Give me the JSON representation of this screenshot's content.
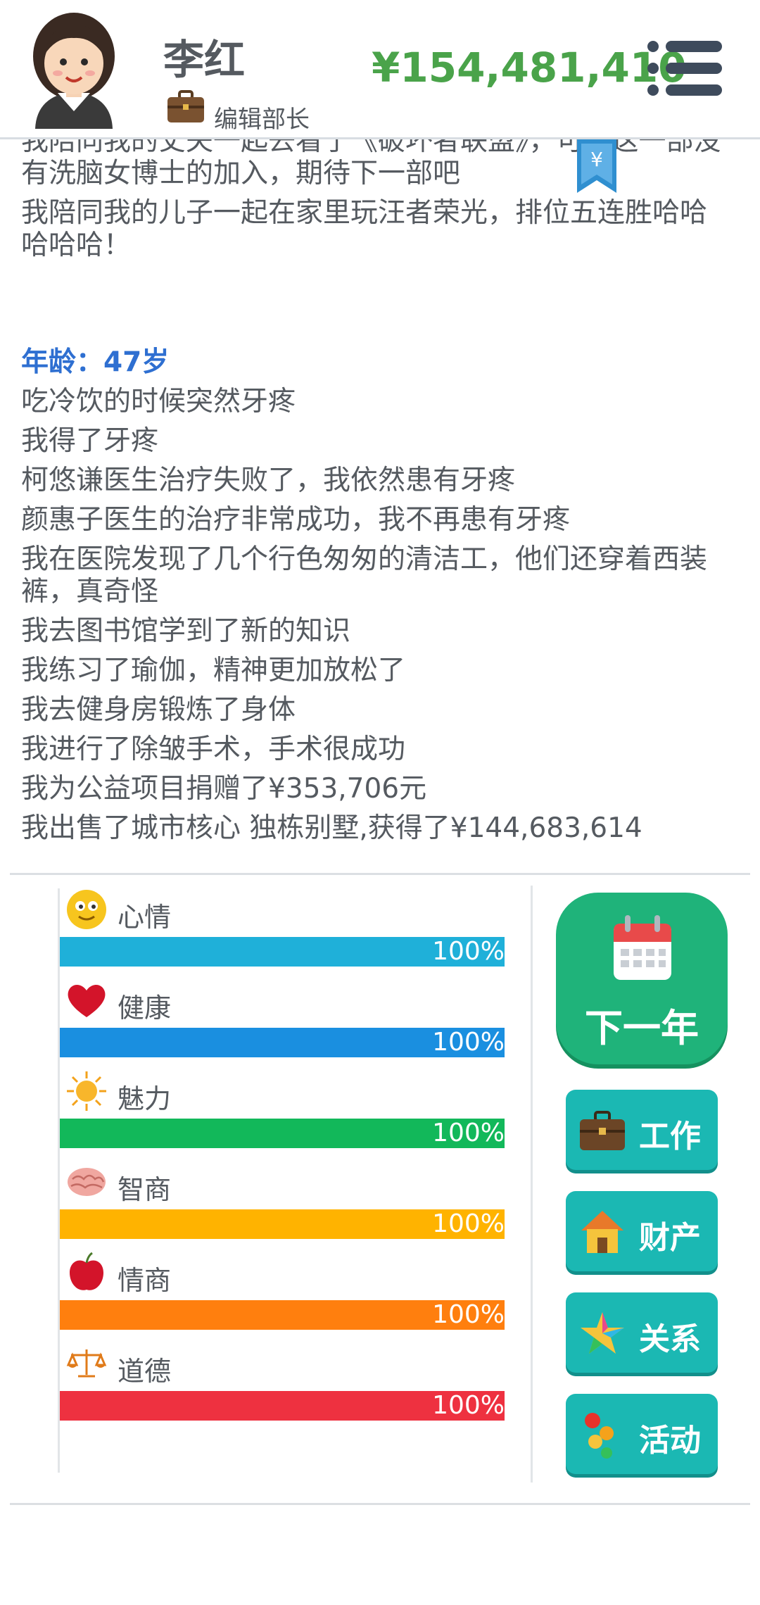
{
  "header": {
    "name": "李红",
    "job_title": "编辑部长",
    "money": "¥154,481,410"
  },
  "log": {
    "previous_lines": [
      "我陪同我的丈夫一起去看了《破坏者联盟》，可惜这一部没有洗脑女博士的加入，期待下一部吧",
      "我陪同我的儿子一起在家里玩汪者荣光，排位五连胜哈哈哈哈哈！"
    ],
    "age_heading": "年龄：47岁",
    "lines": [
      "吃冷饮的时候突然牙疼",
      "我得了牙疼",
      "柯悠谦医生治疗失败了，我依然患有牙疼",
      "颜惠子医生的治疗非常成功，我不再患有牙疼",
      "我在医院发现了几个行色匆匆的清洁工，他们还穿着西装裤，真奇怪",
      "我去图书馆学到了新的知识",
      "我练习了瑜伽，精神更加放松了",
      "我去健身房锻炼了身体",
      "我进行了除皱手术，手术很成功",
      "我为公益项目捐赠了¥353,706元",
      "我出售了城市核心 独栋别墅,获得了¥144,683,614"
    ]
  },
  "stats": [
    {
      "label": "心情",
      "value": 100,
      "text": "100%",
      "color": "#1fb0d9",
      "icon": "smiley-icon"
    },
    {
      "label": "健康",
      "value": 100,
      "text": "100%",
      "color": "#1a8fe0",
      "icon": "heart-icon"
    },
    {
      "label": "魅力",
      "value": 100,
      "text": "100%",
      "color": "#12b85a",
      "icon": "sun-icon"
    },
    {
      "label": "智商",
      "value": 100,
      "text": "100%",
      "color": "#ffb300",
      "icon": "brain-icon"
    },
    {
      "label": "情商",
      "value": 100,
      "text": "100%",
      "color": "#ff7f0e",
      "icon": "apple-icon"
    },
    {
      "label": "道德",
      "value": 100,
      "text": "100%",
      "color": "#ee3140",
      "icon": "scales-icon"
    }
  ],
  "actions": {
    "next_year": "下一年",
    "work": "工作",
    "property": "财产",
    "relations": "关系",
    "activities": "活动"
  },
  "colors": {
    "money": "#4aa34a",
    "age_heading": "#2e6fd1",
    "next_button": "#1fb37a",
    "action_button": "#1bb8b3"
  }
}
